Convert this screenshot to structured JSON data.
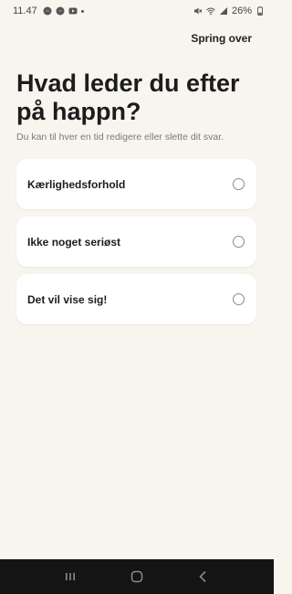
{
  "status_bar": {
    "time": "11.47",
    "battery": "26%",
    "left_icons": [
      "messenger-icon",
      "messenger-icon",
      "youtube-icon"
    ],
    "right_icons": [
      "mute-icon",
      "wifi-icon",
      "signal-icon",
      "battery-icon"
    ]
  },
  "header": {
    "skip_label": "Spring over"
  },
  "main": {
    "title": "Hvad leder du efter på happn?",
    "subtitle": "Du kan til hver en tid redigere eller slette dit svar.",
    "options": [
      {
        "label": "Kærlighedsforhold",
        "selected": false
      },
      {
        "label": "Ikke noget seriøst",
        "selected": false
      },
      {
        "label": "Det vil vise sig!",
        "selected": false
      }
    ]
  },
  "nav_bar": {
    "buttons": [
      "recent-apps-icon",
      "home-icon",
      "back-icon"
    ]
  },
  "colors": {
    "background": "#f8f5ef",
    "card": "#ffffff",
    "text": "#1c1c1c",
    "subtitle": "#7a7a7a",
    "nav_bar": "#141414"
  }
}
